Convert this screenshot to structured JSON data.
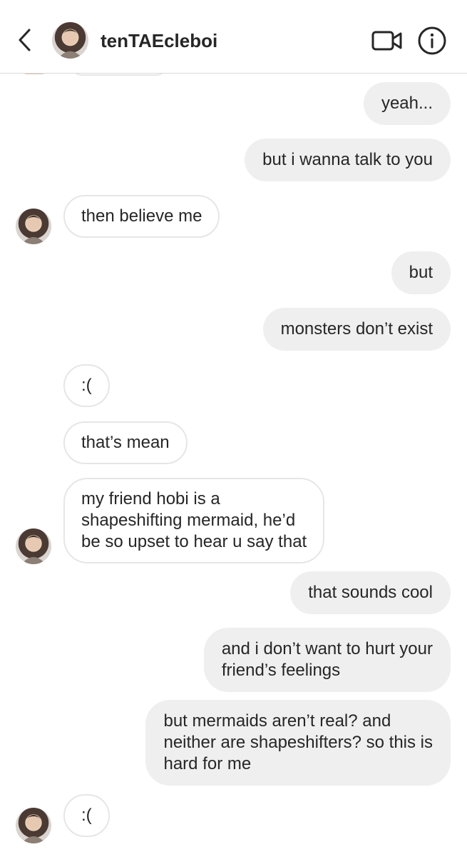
{
  "header": {
    "username": "tenTAEcleboi",
    "back_icon": "chevron-left-icon",
    "video_icon": "video-camera-icon",
    "info_icon": "info-icon"
  },
  "messages": [
    {
      "direction": "outgoing",
      "text": "yeah..."
    },
    {
      "direction": "outgoing",
      "text": "but i wanna talk to you"
    },
    {
      "direction": "incoming",
      "text": "then believe me"
    },
    {
      "direction": "outgoing",
      "text": "but"
    },
    {
      "direction": "outgoing",
      "text": "monsters don’t exist"
    },
    {
      "direction": "incoming",
      "text": ":("
    },
    {
      "direction": "incoming",
      "text": "that’s mean"
    },
    {
      "direction": "incoming",
      "text": "my friend hobi is a\nshapeshifting mermaid, he’d\nbe so upset to hear u say that"
    },
    {
      "direction": "outgoing",
      "text": "that sounds cool"
    },
    {
      "direction": "outgoing",
      "text": "and i don’t want to hurt your\nfriend’s feelings"
    },
    {
      "direction": "outgoing",
      "text": "but mermaids aren’t real? and\nneither are shapeshifters? so this is\nhard for me"
    },
    {
      "direction": "incoming",
      "text": ":("
    }
  ],
  "colors": {
    "outgoing_bubble": "#efefef",
    "incoming_border": "#e6e6e6",
    "text": "#262626"
  }
}
